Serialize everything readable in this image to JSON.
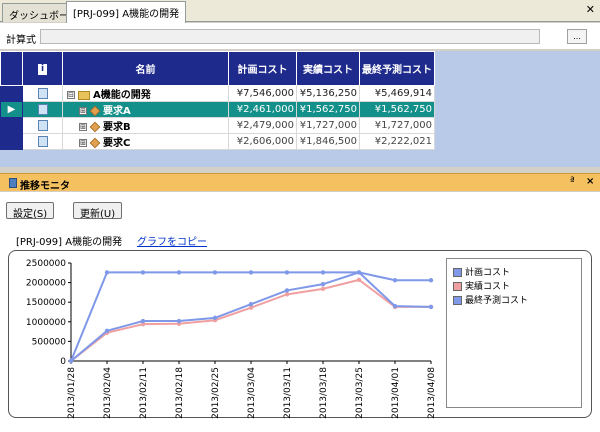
{
  "tabs": [
    {
      "label": "ダッシュボード",
      "active": false
    },
    {
      "label": "[PRJ-099] A機能の開発",
      "active": true
    }
  ],
  "formula": {
    "label": "計算式",
    "button_label": "..."
  },
  "grid": {
    "columns": {
      "info": "i",
      "name": "名前",
      "plan": "計画コスト",
      "actual": "実績コスト",
      "forecast": "最終予測コスト"
    },
    "rows": [
      {
        "name": "A機能の開発",
        "plan": "¥7,546,000",
        "actual": "¥5,136,250",
        "forecast": "¥5,469,914",
        "level": 0,
        "selected": false,
        "expand": "⊟"
      },
      {
        "name": "要求A",
        "plan": "¥2,461,000",
        "actual": "¥1,562,750",
        "forecast": "¥1,562,750",
        "level": 1,
        "selected": true,
        "expand": "⊞"
      },
      {
        "name": "要求B",
        "plan": "¥2,479,000",
        "actual": "¥1,727,000",
        "forecast": "¥1,727,000",
        "level": 1,
        "selected": false,
        "expand": "⊞"
      },
      {
        "name": "要求C",
        "plan": "¥2,606,000",
        "actual": "¥1,846,500",
        "forecast": "¥2,222,021",
        "level": 1,
        "selected": false,
        "expand": "⊞"
      }
    ]
  },
  "monitor": {
    "title": "推移モニタ",
    "settings_button": "設定(S)",
    "refresh_button": "更新(U)",
    "project_label": "[PRJ-099] A機能の開発",
    "copy_link": "グラフをコピー",
    "pin_glyph": "ª",
    "close_glyph": "×"
  },
  "colors": {
    "header": "#1e2a8c",
    "selected": "#14908a",
    "plan": "#7f98e8",
    "actual": "#f0a0a0",
    "forecast": "#7f98e8"
  },
  "chart_data": {
    "type": "line",
    "x": [
      "2013/01/28",
      "2013/02/04",
      "2013/02/11",
      "2013/02/18",
      "2013/02/25",
      "2013/03/04",
      "2013/03/11",
      "2013/03/18",
      "2013/03/25",
      "2013/04/01",
      "2013/04/08"
    ],
    "ylim": [
      0,
      2500000
    ],
    "yticks": [
      "0",
      "500000",
      "1000000",
      "1500000",
      "2000000",
      "2500000"
    ],
    "series": [
      {
        "name": "計画コスト",
        "color": "#7f98e8",
        "values": [
          0,
          2260000,
          2260000,
          2260000,
          2260000,
          2260000,
          2260000,
          2260000,
          2260000,
          2060000,
          2060000
        ]
      },
      {
        "name": "実績コスト",
        "color": "#f0a0a0",
        "values": [
          0,
          720000,
          940000,
          950000,
          1040000,
          1360000,
          1700000,
          1840000,
          2070000,
          1380000,
          1380000
        ]
      },
      {
        "name": "最終予測コスト",
        "color": "#7f98e8",
        "values": [
          0,
          770000,
          1020000,
          1020000,
          1100000,
          1450000,
          1800000,
          1960000,
          2260000,
          1400000,
          1380000
        ]
      }
    ],
    "legend": "right",
    "grid": false
  }
}
